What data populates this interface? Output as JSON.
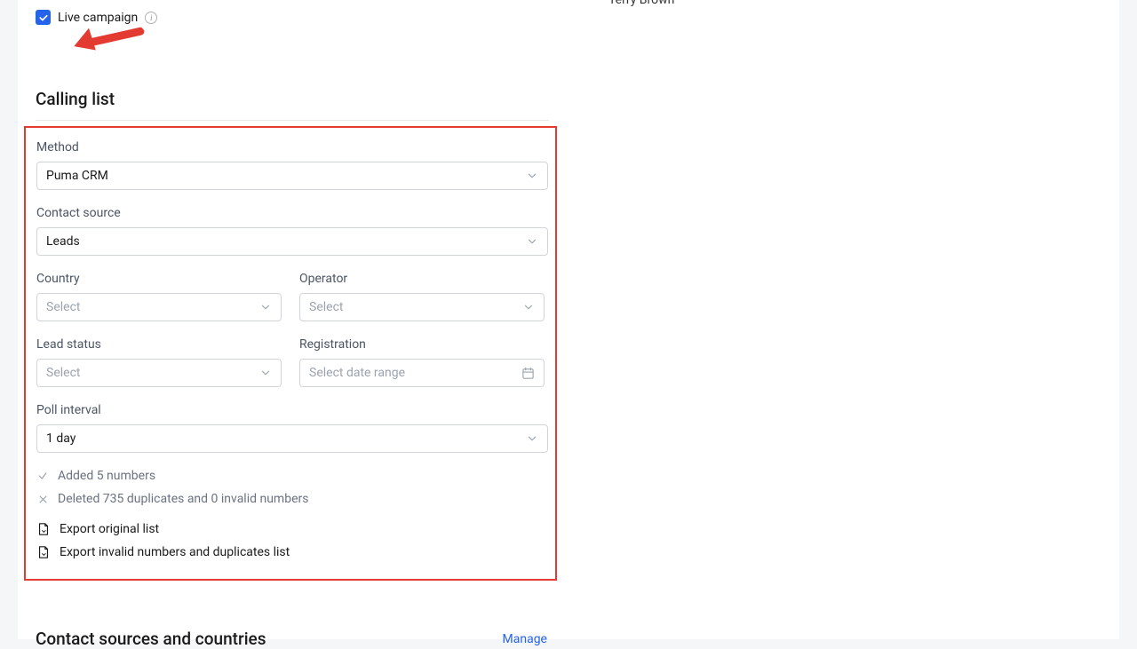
{
  "top_partial": "Terry Brown",
  "live_campaign": {
    "label": "Live campaign",
    "checked": true
  },
  "section_title": "Calling list",
  "fields": {
    "method": {
      "label": "Method",
      "value": "Puma CRM"
    },
    "contact_source": {
      "label": "Contact source",
      "value": "Leads"
    },
    "country": {
      "label": "Country",
      "placeholder": "Select"
    },
    "operator": {
      "label": "Operator",
      "placeholder": "Select"
    },
    "lead_status": {
      "label": "Lead status",
      "placeholder": "Select"
    },
    "registration": {
      "label": "Registration",
      "placeholder": "Select date range"
    },
    "poll_interval": {
      "label": "Poll interval",
      "value": "1 day"
    }
  },
  "status": {
    "added": "Added 5 numbers",
    "deleted": "Deleted 735 duplicates and 0 invalid numbers"
  },
  "exports": {
    "original": "Export original list",
    "invalid": "Export invalid numbers and duplicates list"
  },
  "bottom": {
    "title": "Contact sources and countries",
    "manage": "Manage"
  }
}
